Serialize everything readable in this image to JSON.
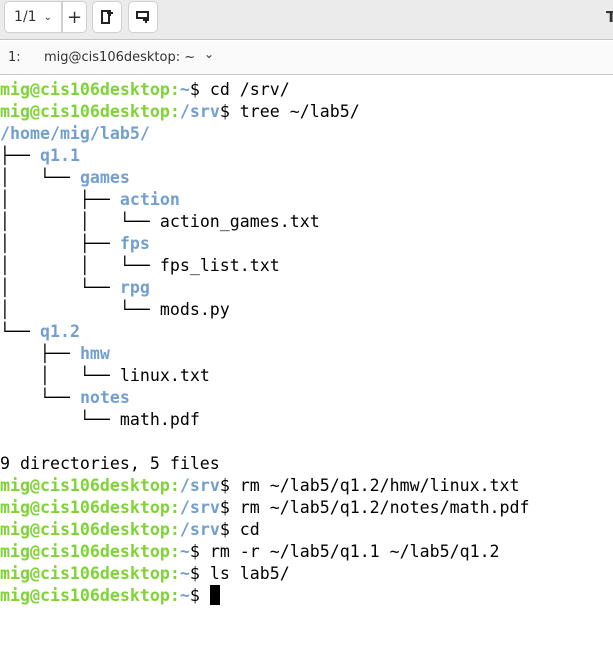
{
  "toolbar": {
    "page_indicator": "1/1",
    "add_label": "+",
    "title_partial": "T"
  },
  "tab": {
    "index": "1:",
    "title": "mig@cis106desktop: ~"
  },
  "colors": {
    "prompt_user": "#7ed434",
    "path": "#729fcf"
  },
  "terminal": {
    "lines": [
      {
        "user": "mig@cis106desktop",
        "path": "~",
        "cmd": " cd /srv/"
      },
      {
        "user": "mig@cis106desktop",
        "path": "/srv",
        "cmd": " tree ~/lab5/"
      },
      {
        "tree": "",
        "dir": "/home/mig/lab5/"
      },
      {
        "tree": "├── ",
        "dir": "q1.1"
      },
      {
        "tree": "│   └── ",
        "dir": "games"
      },
      {
        "tree": "│       ├── ",
        "dir": "action"
      },
      {
        "tree": "│       │   └── ",
        "file": "action_games.txt"
      },
      {
        "tree": "│       ├── ",
        "dir": "fps"
      },
      {
        "tree": "│       │   └── ",
        "file": "fps_list.txt"
      },
      {
        "tree": "│       └── ",
        "dir": "rpg"
      },
      {
        "tree": "│           └── ",
        "file": "mods.py"
      },
      {
        "tree": "└── ",
        "dir": "q1.2"
      },
      {
        "tree": "    ├── ",
        "dir": "hmw"
      },
      {
        "tree": "    │   └── ",
        "file": "linux.txt"
      },
      {
        "tree": "    └── ",
        "dir": "notes"
      },
      {
        "tree": "        └── ",
        "file": "math.pdf"
      },
      {
        "file": ""
      },
      {
        "file": "9 directories, 5 files"
      },
      {
        "user": "mig@cis106desktop",
        "path": "/srv",
        "cmd": " rm ~/lab5/q1.2/hmw/linux.txt"
      },
      {
        "user": "mig@cis106desktop",
        "path": "/srv",
        "cmd": " rm ~/lab5/q1.2/notes/math.pdf"
      },
      {
        "user": "mig@cis106desktop",
        "path": "/srv",
        "cmd": " cd"
      },
      {
        "user": "mig@cis106desktop",
        "path": "~",
        "cmd": " rm -r ~/lab5/q1.1 ~/lab5/q1.2"
      },
      {
        "user": "mig@cis106desktop",
        "path": "~",
        "cmd": " ls lab5/"
      },
      {
        "user": "mig@cis106desktop",
        "path": "~",
        "cmd": " ",
        "cursor": true
      }
    ]
  }
}
